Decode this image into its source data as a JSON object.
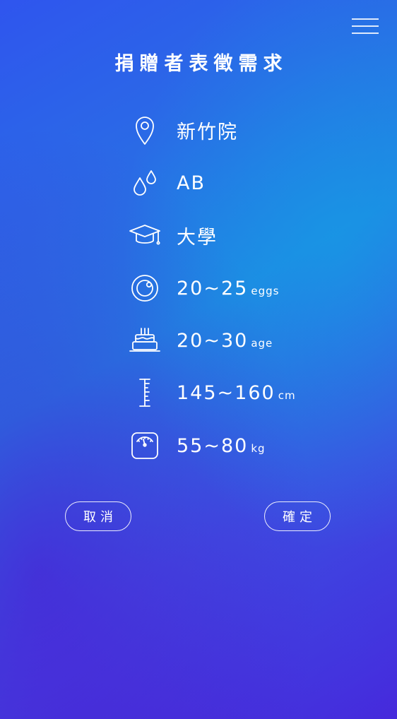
{
  "header": {
    "title": "捐贈者表徵需求",
    "menu_icon": "hamburger-menu-icon"
  },
  "requirements": [
    {
      "icon": "location-pin-icon",
      "value": "新竹院",
      "unit": ""
    },
    {
      "icon": "blood-drops-icon",
      "value": "AB",
      "unit": ""
    },
    {
      "icon": "graduation-cap-icon",
      "value": "大學",
      "unit": ""
    },
    {
      "icon": "egg-ring-icon",
      "value": "20~25",
      "unit": "eggs"
    },
    {
      "icon": "birthday-cake-icon",
      "value": "20~30",
      "unit": "age"
    },
    {
      "icon": "height-ruler-icon",
      "value": "145~160",
      "unit": "cm"
    },
    {
      "icon": "weight-scale-icon",
      "value": "55~80",
      "unit": "kg"
    }
  ],
  "actions": {
    "cancel_label": "取消",
    "confirm_label": "確定"
  },
  "colors": {
    "gradient_top": "#2f55ee",
    "gradient_mid": "#1f86e2",
    "gradient_bottom": "#4a22d8",
    "foreground": "#ffffff"
  }
}
